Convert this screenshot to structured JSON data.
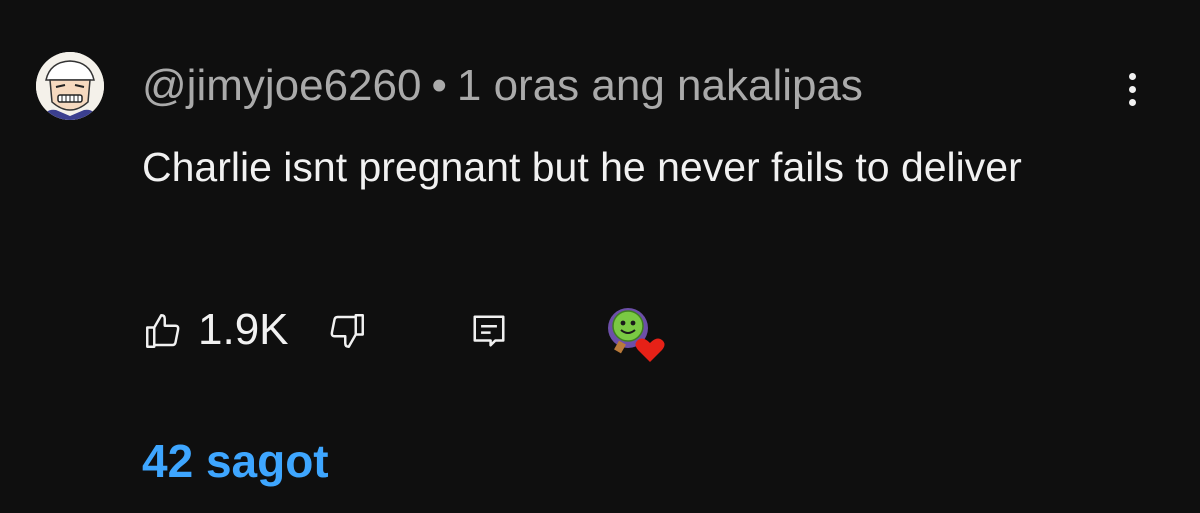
{
  "comment": {
    "author": "@jimyjoe6260",
    "separator": "•",
    "time": "1 oras ang nakalipas",
    "text": "Charlie isnt pregnant but he never fails to deliver",
    "avatar_icon": "anime-character-avatar"
  },
  "actions": {
    "like_icon": "thumb-up-icon",
    "like_count": "1.9K",
    "dislike_icon": "thumb-down-icon",
    "reply_icon": "reply-icon",
    "creator_heart_icon": "creator-heart-icon"
  },
  "replies": {
    "label": "42 sagot"
  },
  "menu": {
    "icon": "more-vertical-icon"
  },
  "colors": {
    "background": "#0f0f0f",
    "text_primary": "#f1f1f1",
    "text_secondary": "#aaaaaa",
    "link": "#3ea6ff",
    "heart": "#e62117"
  }
}
